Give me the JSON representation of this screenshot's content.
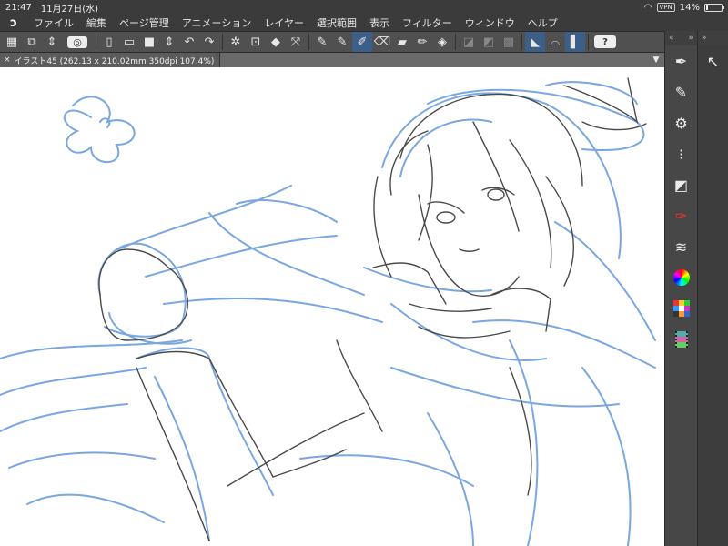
{
  "status_bar": {
    "time": "21:47",
    "date": "11月27日(水)",
    "vpn": "VPN",
    "battery": "14%",
    "battery_level": 0.14
  },
  "menu": {
    "items": [
      "ファイル",
      "編集",
      "ページ管理",
      "アニメーション",
      "レイヤー",
      "選択範囲",
      "表示",
      "フィルター",
      "ウィンドウ",
      "ヘルプ"
    ]
  },
  "toolbar": {
    "help_label": "?"
  },
  "canvas_tab": {
    "close": "×",
    "title": "イラスト45 (262.13 x 210.02mm 350dpi 107.4%)",
    "dropdown": "▼"
  },
  "panels": {
    "collapse_left": "«",
    "collapse_right": "»"
  },
  "colors": {
    "sketch_blue": "#7aa7e0",
    "ink": "#4a4a4a",
    "accent": "#3c5f8a"
  }
}
